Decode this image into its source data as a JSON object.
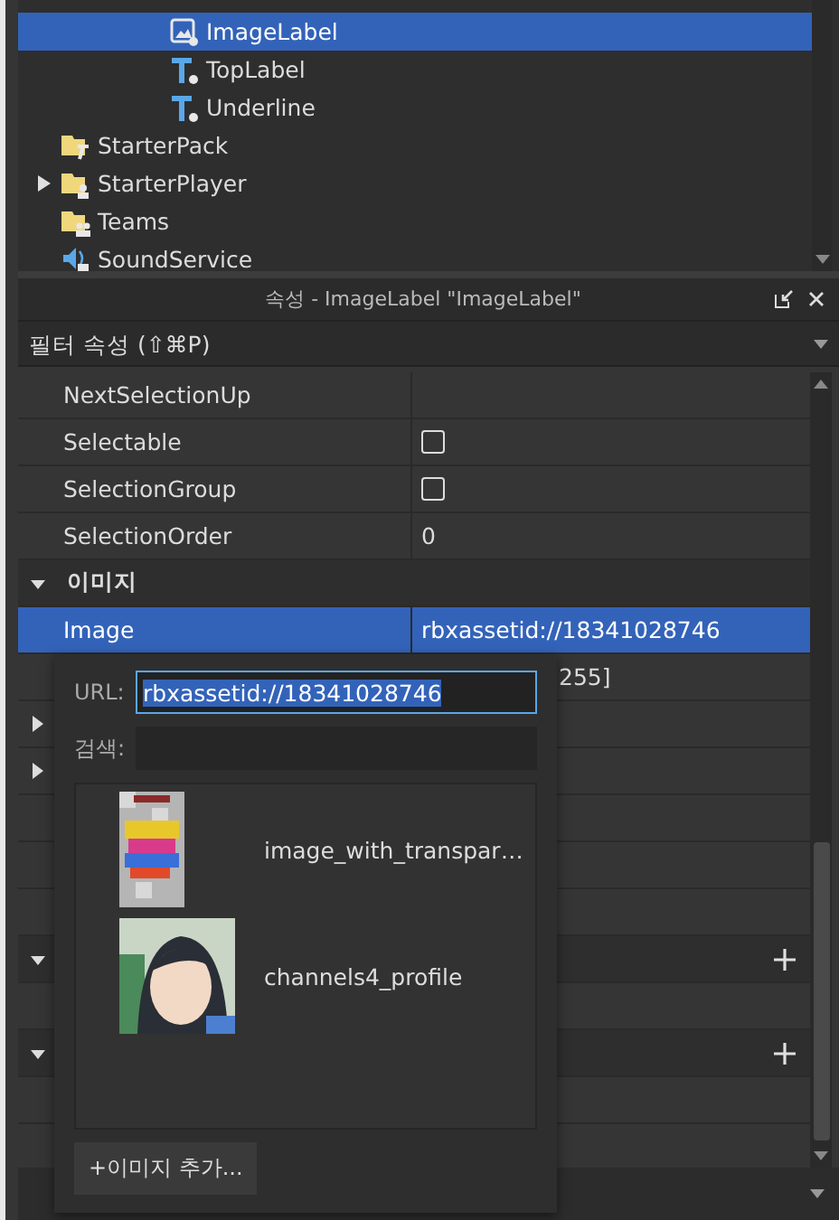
{
  "explorer": {
    "items": [
      {
        "children": [
          {
            "children": [
              {
                "children": [
                  {
                    "name": "ImageLabel",
                    "kind": "image-label",
                    "selected": true
                  },
                  {
                    "name": "TopLabel",
                    "kind": "text-label",
                    "selected": false
                  },
                  {
                    "name": "Underline",
                    "kind": "text-label",
                    "selected": false
                  }
                ]
              }
            ]
          }
        ]
      },
      {
        "name": "StarterPack",
        "kind": "starter-pack",
        "selected": false,
        "expandable": false
      },
      {
        "name": "StarterPlayer",
        "kind": "starter-player",
        "selected": false,
        "expandable": true
      },
      {
        "name": "Teams",
        "kind": "teams",
        "selected": false,
        "expandable": false
      },
      {
        "name": "SoundService",
        "kind": "sound-service",
        "selected": false,
        "expandable": false
      }
    ]
  },
  "properties": {
    "title": "속성 - ImageLabel \"ImageLabel\"",
    "filter_placeholder": "필터 속성 (⇧⌘P)",
    "rows": [
      {
        "kind": "prop",
        "name": "NextSelectionUp",
        "selected": false
      },
      {
        "kind": "check",
        "name": "Selectable",
        "checked": false,
        "selected": false
      },
      {
        "kind": "check",
        "name": "SelectionGroup",
        "checked": false,
        "selected": false
      },
      {
        "kind": "prop",
        "name": "SelectionOrder",
        "value": "0",
        "selected": false
      },
      {
        "kind": "category",
        "name": "이미지",
        "expanded": true
      },
      {
        "kind": "prop",
        "name": "Image",
        "value": "rbxassetid://18341028746",
        "selected": true
      },
      {
        "kind": "covered-prop",
        "value": "255]",
        "selected": false
      },
      {
        "kind": "prop",
        "expanded": false,
        "selected": false
      },
      {
        "kind": "prop",
        "expanded": false,
        "selected": false
      },
      {
        "kind": "prop",
        "selected": false
      },
      {
        "kind": "prop",
        "selected": false
      },
      {
        "kind": "prop",
        "selected": false
      },
      {
        "kind": "category",
        "expanded": true,
        "addable": true
      },
      {
        "kind": "prop",
        "selected": false
      },
      {
        "kind": "category",
        "expanded": true,
        "addable": true
      },
      {
        "kind": "prop",
        "selected": false
      }
    ]
  },
  "image_picker": {
    "url_label": "URL:",
    "url_value": "rbxassetid://18341028746",
    "search_label": "검색:",
    "images": [
      {
        "name": "image_with_transpar…",
        "kind": "picture"
      },
      {
        "name": "channels4_profile",
        "kind": "picture"
      }
    ],
    "add_button": "+이미지 추가..."
  }
}
